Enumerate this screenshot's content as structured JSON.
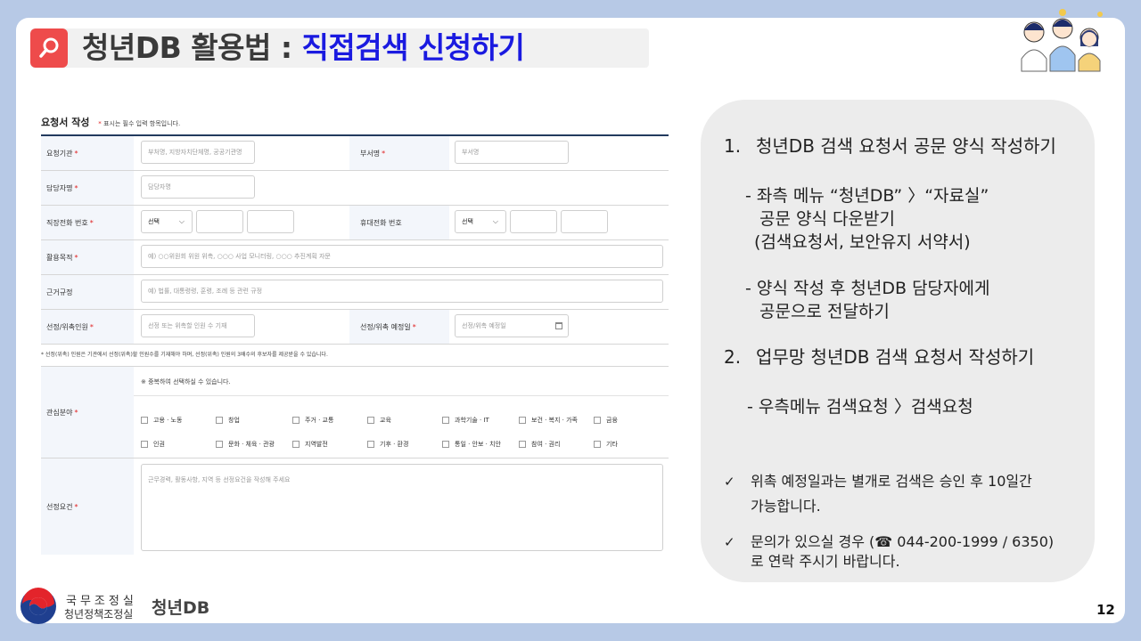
{
  "header": {
    "title_prefix": "청년DB 활용법 : ",
    "title_accent": "직접검색 신청하기"
  },
  "form": {
    "heading": "요청서 작성",
    "required_note_mark": "*",
    "required_note": "표시는 필수 입력 항목입니다.",
    "rows": {
      "requesting_org": {
        "label": "요청기관",
        "placeholder": "부처명, 지방자치단체명, 공공기관명"
      },
      "department": {
        "label": "부서명",
        "placeholder": "부서명"
      },
      "officer": {
        "label": "담당자명",
        "placeholder": "담당자명"
      },
      "office_phone": {
        "label": "직장전화 번호",
        "select": "선택"
      },
      "mobile_phone": {
        "label": "휴대전화 번호",
        "select": "선택"
      },
      "purpose": {
        "label": "활용목적",
        "placeholder": "예) ○○위원회 위원 위촉, ○○○ 사업 모니터링, ○○○ 추진계획 자문"
      },
      "legal_basis": {
        "label": "근거규정",
        "placeholder": "예) 법률, 대통령령, 훈령, 조례 등 관련 규정"
      },
      "selection_count": {
        "label": "선정/위촉인원",
        "placeholder": "선정 또는 위촉할 인원 수 기재"
      },
      "appointment_date": {
        "label": "선정/위촉 예정일",
        "placeholder": "선정/위촉 예정일"
      },
      "footnote": "* 선정(위촉) 인원은 기관에서 선정(위촉)할 인원수를 기재해야 하며, 선정(위촉) 인원의 3배수의 후보자를 제공받을 수 있습니다.",
      "interests": {
        "label": "관심분야",
        "note": "※ 중복하여 선택하실 수 있습니다.",
        "options_row1": [
          "고용 · 노동",
          "창업",
          "주거 · 교통",
          "교육",
          "과학기술 · IT",
          "보건 · 복지 · 가족",
          "금융"
        ],
        "options_row2": [
          "인권",
          "문화 · 체육 · 관광",
          "지역발전",
          "기후 · 환경",
          "통일 · 안보 · 치안",
          "참여 · 권리",
          "기타"
        ]
      },
      "requirements": {
        "label": "선정요건",
        "placeholder": "근무경력, 활동사항, 지역 등 선정요건을 작성해 주세요"
      }
    }
  },
  "info_panel": {
    "item1_num": "1.",
    "item1_title": "청년DB 검색 요청서 공문 양식 작성하기",
    "item1_sub1_line1": "- 좌측 메뉴 “청년DB” 〉“자료실”",
    "item1_sub1_line2": "공문 양식 다운받기",
    "item1_sub1_line3": "(검색요청서, 보안유지 서약서)",
    "item1_sub2_line1": "- 양식 작성 후 청년DB 담당자에게",
    "item1_sub2_line2": "공문으로 전달하기",
    "item2_num": "2.",
    "item2_title": "업무망 청년DB 검색 요청서 작성하기",
    "item2_sub1": "- 우측메뉴 검색요청 〉검색요청",
    "check_mark": "✓",
    "note1_line1": "위촉 예정일과는 별개로 검색은 승인 후 10일간",
    "note1_line2": "가능합니다.",
    "note2_line1": "문의가 있으실 경우 (☎ 044-200-1999 / 6350)",
    "note2_line2": "로 연락 주시기 바랍니다."
  },
  "footer": {
    "org_line1": "국무조정실",
    "org_line2": "청년정책조정실",
    "brand": "청년DB",
    "page_number": "12"
  },
  "colors": {
    "background": "#b7c9e6",
    "accent_blue": "#1a1ae0",
    "badge_red": "#ee4b4b",
    "form_rule": "#223a5e"
  }
}
